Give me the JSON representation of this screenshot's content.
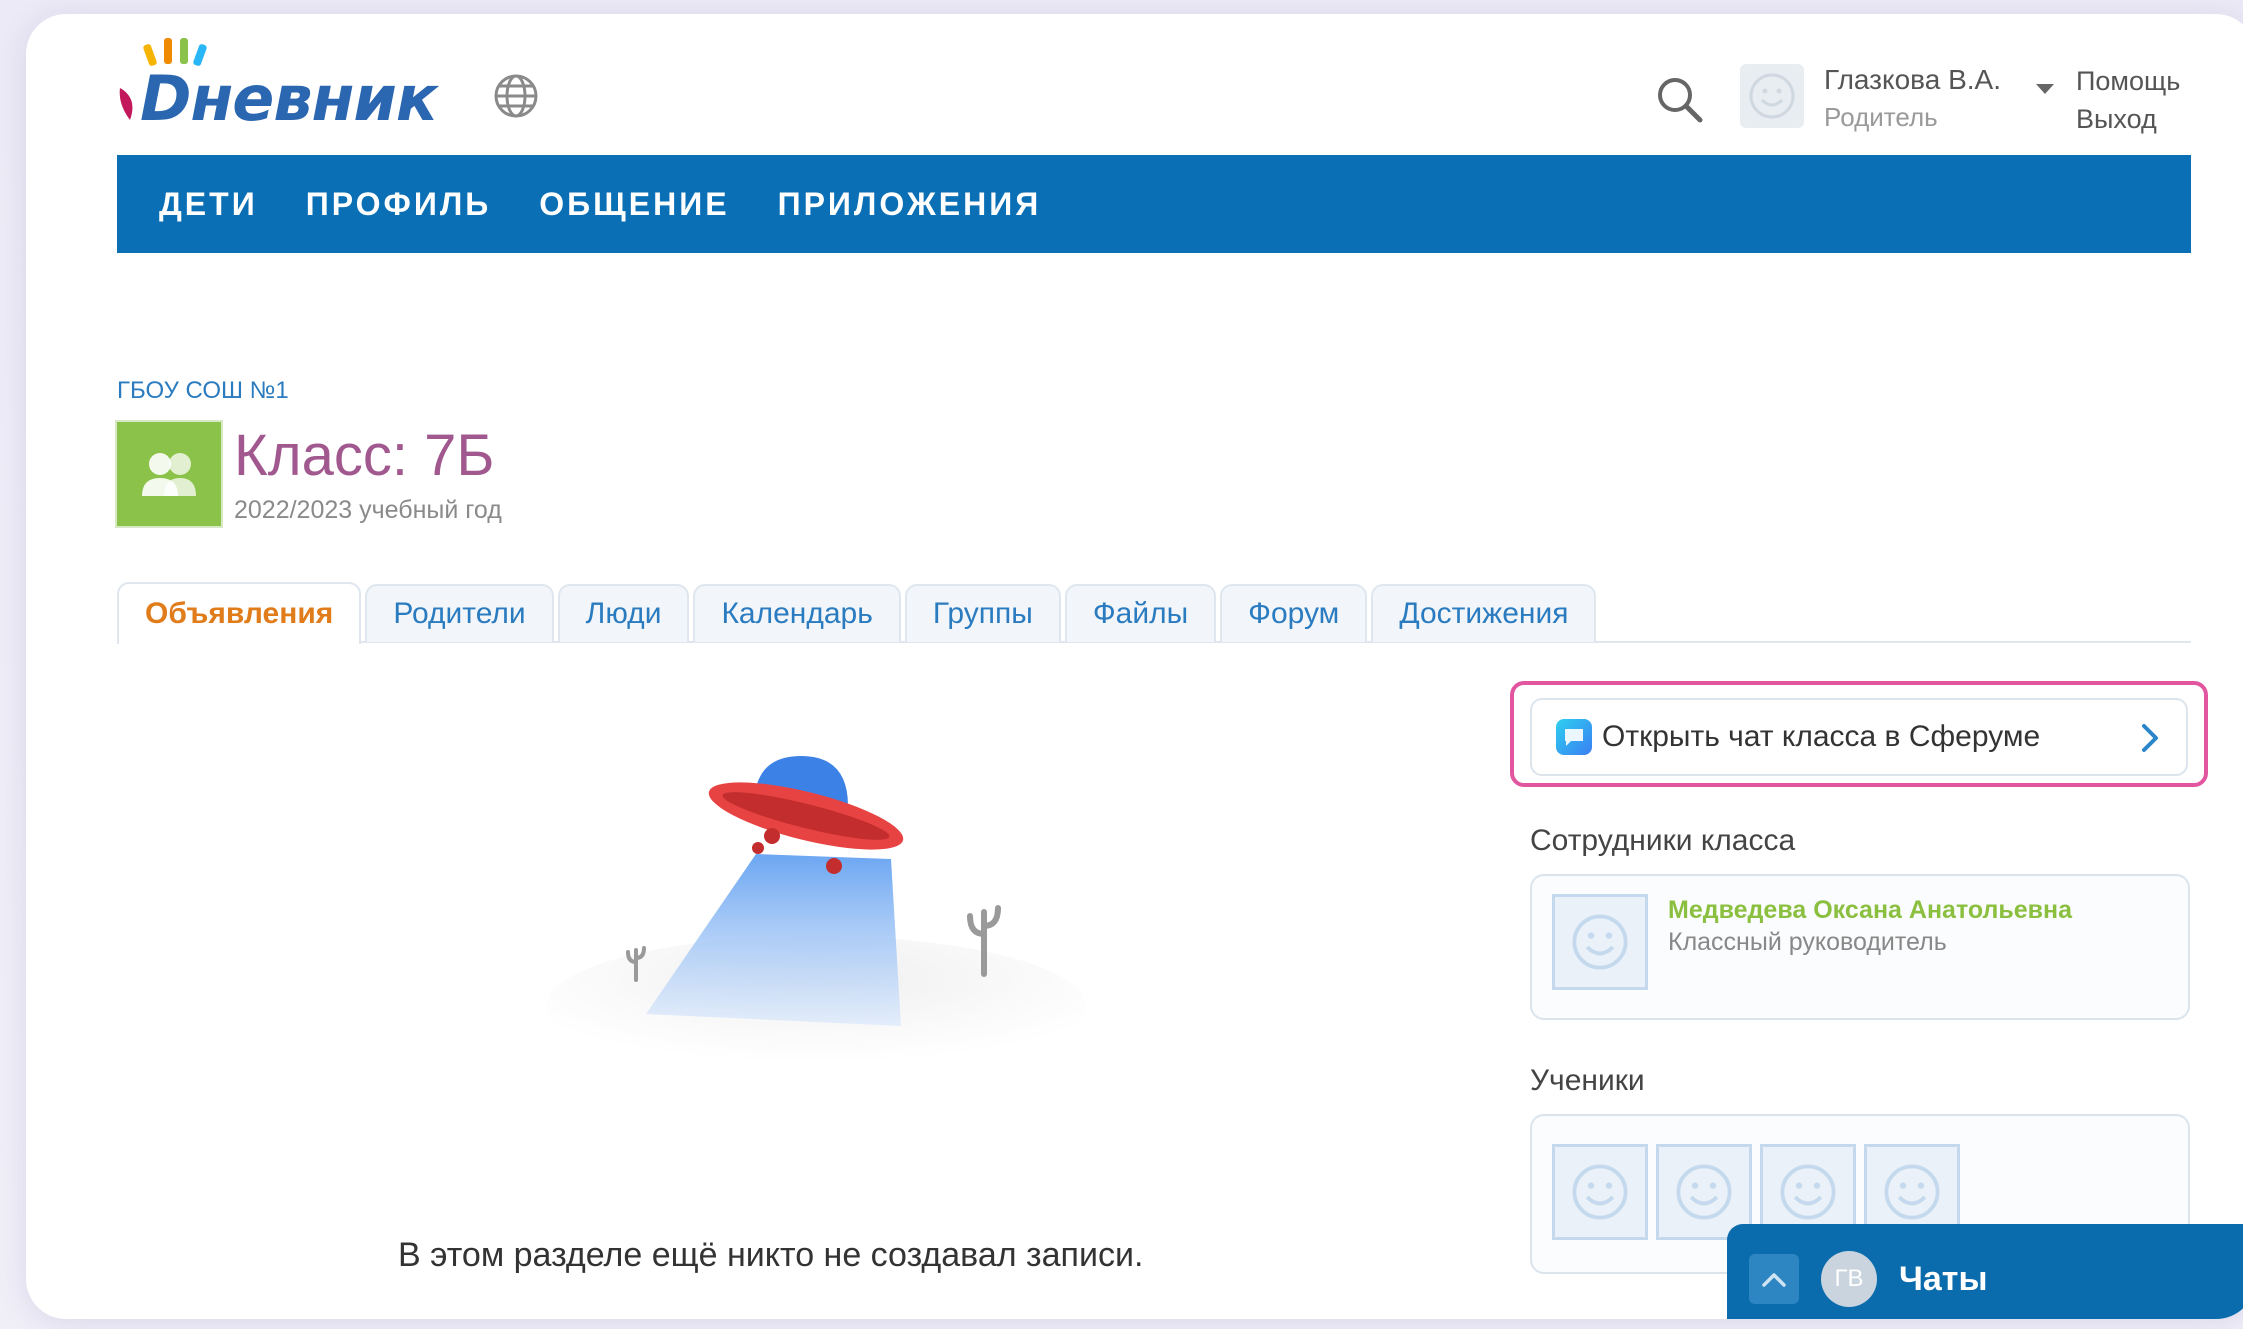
{
  "header": {
    "logo_text": "Dневник",
    "user": {
      "name": "Глазкова В.А.",
      "role": "Родитель"
    },
    "help_label": "Помощь",
    "logout_label": "Выход"
  },
  "nav": {
    "items": [
      "ДЕТИ",
      "ПРОФИЛЬ",
      "ОБЩЕНИЕ",
      "ПРИЛОЖЕНИЯ"
    ]
  },
  "class_header": {
    "school": "ГБОУ СОШ №1",
    "title": "Класс: 7Б",
    "year": "2022/2023 учебный год"
  },
  "tabs": {
    "active_index": 0,
    "items": [
      "Объявления",
      "Родители",
      "Люди",
      "Календарь",
      "Группы",
      "Файлы",
      "Форум",
      "Достижения"
    ]
  },
  "empty_state": {
    "message": "В этом разделе ещё никто не создавал записи."
  },
  "sidebar": {
    "sferum_button": "Открыть чат класса в Сферуме",
    "staff_title": "Сотрудники класса",
    "staff": [
      {
        "name": "Медведева Оксана Анатольевна",
        "role": "Классный руководитель"
      }
    ],
    "students_title": "Ученики"
  },
  "chats": {
    "avatar_initials": "ГВ",
    "label": "Чаты"
  },
  "colors": {
    "nav_bg": "#0a6fb5",
    "active_tab": "#e07c1a",
    "class_title": "#a0588e",
    "highlight": "#e2559f",
    "staff_name": "#8bbf3f"
  }
}
